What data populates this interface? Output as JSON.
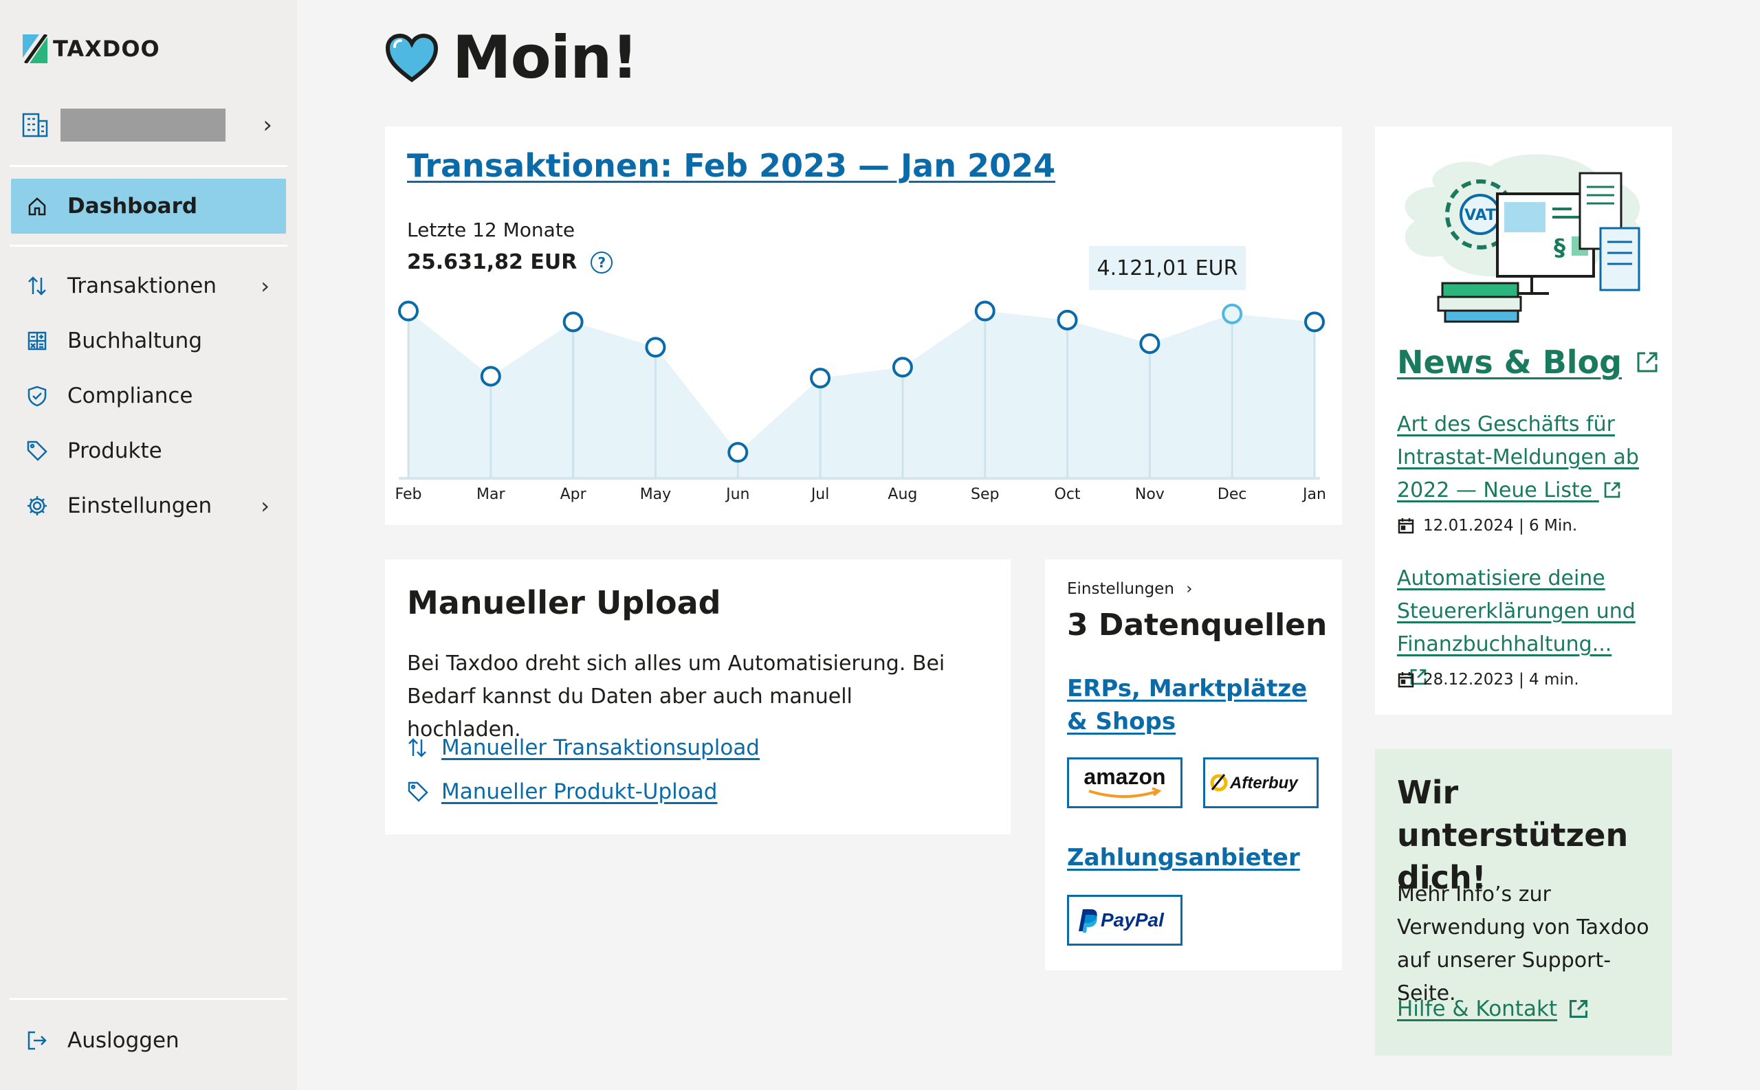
{
  "brand": {
    "name": "TAXDOO"
  },
  "sidebar": {
    "company_name": "",
    "items": [
      {
        "label": "Dashboard",
        "icon": "home-icon",
        "active": true
      },
      {
        "label": "Transaktionen",
        "icon": "transactions-arrows-icon",
        "has_submenu": true
      },
      {
        "label": "Buchhaltung",
        "icon": "calculator-icon"
      },
      {
        "label": "Compliance",
        "icon": "shield-check-icon"
      },
      {
        "label": "Produkte",
        "icon": "tag-icon"
      },
      {
        "label": "Einstellungen",
        "icon": "gear-icon",
        "has_submenu": true
      }
    ],
    "logout": {
      "label": "Ausloggen",
      "icon": "logout-icon"
    }
  },
  "greeting": {
    "text": "Moin!",
    "icon": "heart-icon"
  },
  "transactions": {
    "title": "Transaktionen: Feb 2023 — Jan 2024",
    "subtitle": "Letzte 12 Monate",
    "total": "25.631,82 EUR",
    "tooltip": "4.121,01 EUR"
  },
  "chart_data": {
    "type": "area",
    "categories": [
      "Feb",
      "Mar",
      "Apr",
      "May",
      "Jun",
      "Jul",
      "Aug",
      "Sep",
      "Oct",
      "Nov",
      "Dec",
      "Jan"
    ],
    "values": [
      4200,
      2400,
      3900,
      3200,
      300,
      2350,
      2650,
      4200,
      3950,
      3300,
      4121.01,
      3900
    ],
    "ylim": [
      0,
      4400
    ],
    "highlighted_index": 10,
    "grid": false,
    "colors": {
      "line": "#0b6aa8",
      "fill": "#e3f2f8",
      "highlight": "#4fb8e0"
    }
  },
  "upload": {
    "title": "Manueller Upload",
    "description": "Bei Taxdoo dreht sich alles um Automatisierung. Bei Bedarf kannst du Daten aber auch manuell hochladen.",
    "links": [
      {
        "label": "Manueller Transaktionsupload",
        "icon": "transactions-arrows-icon"
      },
      {
        "label": "Manueller Produkt-Upload",
        "icon": "tag-icon"
      }
    ]
  },
  "datasources": {
    "breadcrumb": "Einstellungen",
    "title": "3 Datenquellen",
    "erp_label": "ERPs, Marktplätze & Shops",
    "payment_label": "Zahlungsanbieter",
    "partners": [
      "amazon",
      "Afterbuy",
      "PayPal"
    ]
  },
  "news": {
    "title": "News & Blog",
    "articles": [
      {
        "title": "Art des Geschäfts für Intrastat-Meldungen ab 2022 — Neue Liste",
        "date": "12.01.2024 | 6 Min."
      },
      {
        "title": "Automatisiere deine Steuererklärungen und Finanzbuchhaltung...",
        "date": "28.12.2023 | 4 min."
      }
    ]
  },
  "support": {
    "title": "Wir unterstützen dich!",
    "description": "Mehr Info’s zur Verwendung von Taxdoo auf unserer Support-Seite.",
    "link": "Hilfe & Kontakt"
  },
  "colors": {
    "accent": "#0b6aa8",
    "active_nav": "#8ecfea",
    "green": "#1a7a5e",
    "support_bg": "#e2f0e4"
  }
}
